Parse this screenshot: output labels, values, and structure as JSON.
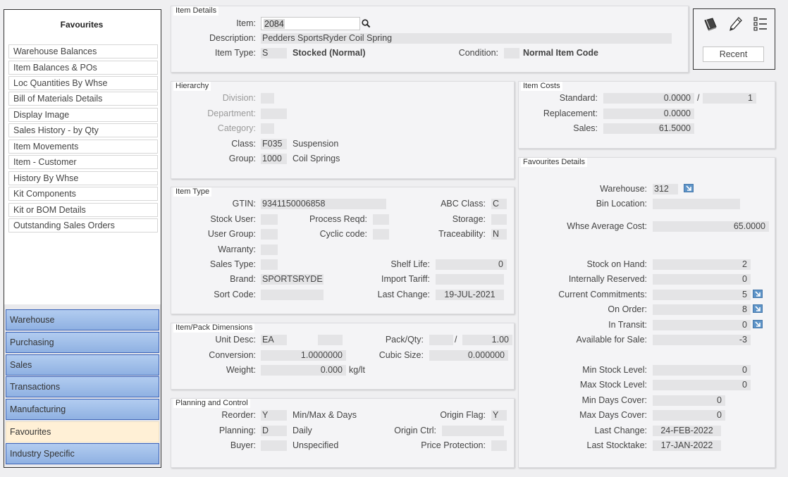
{
  "favourites": {
    "title": "Favourites",
    "items": [
      "Warehouse Balances",
      "Item Balances & POs",
      "Loc Quantities By Whse",
      "Bill of Materials Details",
      "Display Image",
      "Sales History - by Qty",
      "Item Movements",
      "Item - Customer",
      "History By Whse",
      "Kit Components",
      "Kit or BOM Details",
      "Outstanding Sales Orders"
    ]
  },
  "modules": [
    "Warehouse",
    "Purchasing",
    "Sales",
    "Transactions",
    "Manufacturing",
    "Favourites",
    "Industry Specific"
  ],
  "item_details": {
    "title": "Item Details",
    "item_label": "Item:",
    "item_value": "2084",
    "description_label": "Description:",
    "description_value": "Pedders SportsRyder Coil Spring",
    "item_type_label": "Item Type:",
    "item_type_code": "S",
    "item_type_desc": "Stocked (Normal)",
    "condition_label": "Condition:",
    "condition_code": "",
    "condition_desc": "Normal Item Code"
  },
  "toolbox": {
    "recent_label": "Recent"
  },
  "hierarchy": {
    "title": "Hierarchy",
    "division_label": "Division:",
    "department_label": "Department:",
    "category_label": "Category:",
    "class_label": "Class:",
    "class_code": "F035",
    "class_desc": "Suspension",
    "group_label": "Group:",
    "group_code": "1000",
    "group_desc": "Coil Springs"
  },
  "item_costs": {
    "title": "Item Costs",
    "standard_label": "Standard:",
    "standard_value": "0.0000",
    "slash": "/",
    "standard_per": "1",
    "replacement_label": "Replacement:",
    "replacement_value": "0.0000",
    "sales_label": "Sales:",
    "sales_value": "61.5000"
  },
  "item_type": {
    "title": "Item Type",
    "gtin_label": "GTIN:",
    "gtin_value": "9341150006858",
    "abc_label": "ABC Class:",
    "abc_value": "C",
    "stock_user_label": "Stock User:",
    "process_reqd_label": "Process Reqd:",
    "storage_label": "Storage:",
    "user_group_label": "User Group:",
    "cyclic_code_label": "Cyclic code:",
    "traceability_label": "Traceability:",
    "traceability_value": "N",
    "warranty_label": "Warranty:",
    "sales_type_label": "Sales Type:",
    "shelf_life_label": "Shelf Life:",
    "shelf_life_value": "0",
    "brand_label": "Brand:",
    "brand_value": "SPORTSRYDE",
    "import_tariff_label": "Import Tariff:",
    "sort_code_label": "Sort Code:",
    "last_change_label": "Last Change:",
    "last_change_value": "19-JUL-2021"
  },
  "dimensions": {
    "title": "Item/Pack Dimensions",
    "unit_desc_label": "Unit Desc:",
    "unit_desc_value": "EA",
    "pack_qty_label": "Pack/Qty:",
    "pack_slash": "/",
    "pack_qty_value": "1.00",
    "conversion_label": "Conversion:",
    "conversion_value": "1.0000000",
    "cubic_size_label": "Cubic Size:",
    "cubic_size_value": "0.000000",
    "weight_label": "Weight:",
    "weight_value": "0.000",
    "weight_unit": "kg/lt"
  },
  "planning": {
    "title": "Planning and Control",
    "reorder_label": "Reorder:",
    "reorder_code": "Y",
    "reorder_desc": "Min/Max & Days",
    "origin_flag_label": "Origin Flag:",
    "origin_flag_value": "Y",
    "planning_label": "Planning:",
    "planning_code": "D",
    "planning_desc": "Daily",
    "origin_ctrl_label": "Origin Ctrl:",
    "buyer_label": "Buyer:",
    "buyer_desc": "Unspecified",
    "price_protection_label": "Price Protection:"
  },
  "fav_details": {
    "title": "Favourites Details",
    "warehouse_label": "Warehouse:",
    "warehouse_value": "312",
    "bin_location_label": "Bin Location:",
    "whse_avg_cost_label": "Whse Average Cost:",
    "whse_avg_cost_value": "65.0000",
    "stock_on_hand_label": "Stock on Hand:",
    "stock_on_hand_value": "2",
    "internally_reserved_label": "Internally Reserved:",
    "internally_reserved_value": "0",
    "current_commitments_label": "Current Commitments:",
    "current_commitments_value": "5",
    "on_order_label": "On Order:",
    "on_order_value": "8",
    "in_transit_label": "In Transit:",
    "in_transit_value": "0",
    "available_label": "Available for Sale:",
    "available_value": "-3",
    "min_stock_label": "Min Stock Level:",
    "min_stock_value": "0",
    "max_stock_label": "Max Stock Level:",
    "max_stock_value": "0",
    "min_days_label": "Min Days Cover:",
    "min_days_value": "0",
    "max_days_label": "Max Days Cover:",
    "max_days_value": "0",
    "last_change_label": "Last Change:",
    "last_change_value": "24-FEB-2022",
    "last_stocktake_label": "Last Stocktake:",
    "last_stocktake_value": "17-JAN-2022"
  },
  "colors": {
    "module_blue": "#9dbbe8",
    "module_active": "#fff0d6",
    "arrow_blue": "#5e94c8"
  }
}
